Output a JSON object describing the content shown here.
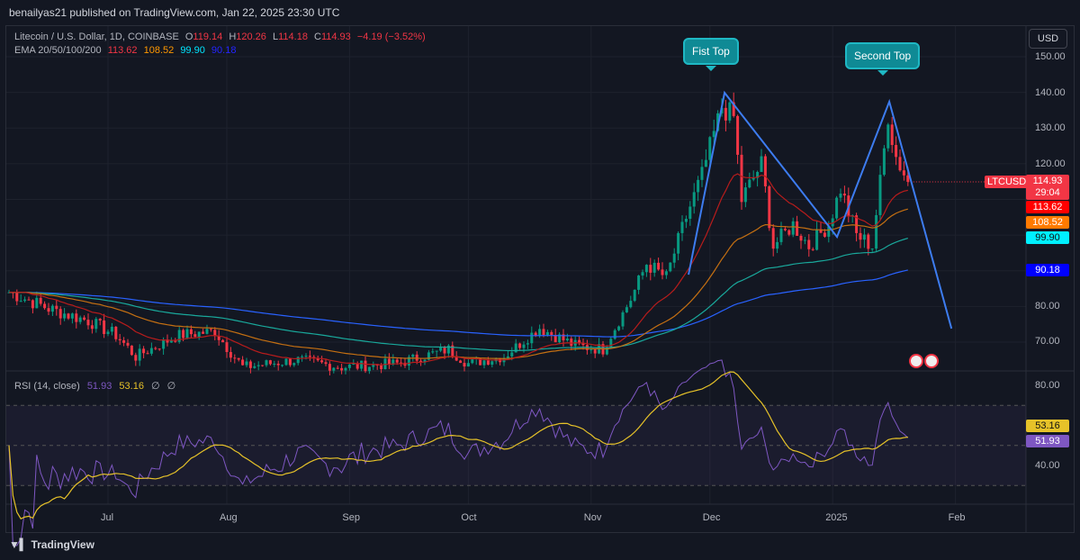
{
  "header": "benailyas21 published on TradingView.com, Jan 22, 2025 23:30 UTC",
  "legend": {
    "symbol": "Litecoin / U.S. Dollar, 1D, COINBASE",
    "o_label": "O",
    "o": "119.14",
    "h_label": "H",
    "h": "120.26",
    "l_label": "L",
    "l": "114.18",
    "c_label": "C",
    "c": "114.93",
    "change": "−4.19 (−3.52%)",
    "ema_label": "EMA 20/50/100/200",
    "ema20": "113.62",
    "ema50": "108.52",
    "ema100": "99.90",
    "ema200": "90.18"
  },
  "rsi_legend": {
    "label": "RSI (14, close)",
    "rsi": "51.93",
    "ma": "53.16",
    "x1": "∅",
    "x2": "∅"
  },
  "currency": "USD",
  "price_axis": [
    "150.00",
    "140.00",
    "130.00",
    "120.00",
    "80.00",
    "70.00"
  ],
  "rsi_axis": [
    "80.00",
    "40.00"
  ],
  "time_axis": [
    {
      "label": "Jul",
      "day": 25
    },
    {
      "label": "Aug",
      "day": 55
    },
    {
      "label": "Sep",
      "day": 86
    },
    {
      "label": "Oct",
      "day": 116
    },
    {
      "label": "Nov",
      "day": 147
    },
    {
      "label": "Dec",
      "day": 177
    },
    {
      "label": "2025",
      "day": 208
    },
    {
      "label": "Feb",
      "day": 239
    }
  ],
  "tags": {
    "symbol": "LTCUSD",
    "price": "114.93",
    "countdown": "29:04",
    "ema20": "113.62",
    "ema50": "108.52",
    "ema100": "99.90",
    "ema200": "90.18",
    "rsi_ma": "53.16",
    "rsi": "51.93"
  },
  "annotations": {
    "first_top": "Fist Top",
    "second_top": "Second Top"
  },
  "footer": "TradingView",
  "colors": {
    "up": "#089981",
    "down": "#f23645",
    "ema20": "#b71c1c",
    "ema50": "#c46f12",
    "ema100": "#19a89b",
    "ema200": "#2962ff",
    "pattern": "#3d7cf0",
    "rsi": "#7e57c2",
    "rsi_ma": "#e6c229"
  },
  "chart_data": {
    "type": "candlestick",
    "path": [
      [
        0,
        84
      ],
      [
        11,
        79
      ],
      [
        20,
        76
      ],
      [
        27,
        72
      ],
      [
        32,
        66
      ],
      [
        43,
        72
      ],
      [
        52,
        73
      ],
      [
        59,
        63
      ],
      [
        73,
        65
      ],
      [
        84,
        63
      ],
      [
        98,
        64
      ],
      [
        111,
        68
      ],
      [
        116,
        64
      ],
      [
        125,
        66
      ],
      [
        134,
        74
      ],
      [
        143,
        69
      ],
      [
        150,
        68
      ],
      [
        157,
        82
      ],
      [
        161,
        92
      ],
      [
        166,
        88
      ],
      [
        170,
        102
      ],
      [
        175,
        117
      ],
      [
        180,
        136
      ],
      [
        183,
        133
      ],
      [
        185,
        110
      ],
      [
        190,
        120
      ],
      [
        193,
        97
      ],
      [
        198,
        103
      ],
      [
        202,
        97
      ],
      [
        207,
        103
      ],
      [
        210,
        113
      ],
      [
        214,
        100
      ],
      [
        218,
        97
      ],
      [
        222,
        133
      ],
      [
        224,
        122
      ],
      [
        227,
        115
      ]
    ],
    "pattern": [
      [
        171.6,
        88.9
      ],
      [
        180.7,
        139.9
      ],
      [
        209.1,
        99.5
      ],
      [
        222.3,
        137.4
      ],
      [
        238,
        73.8
      ]
    ],
    "ylim": [
      62,
      155
    ]
  }
}
